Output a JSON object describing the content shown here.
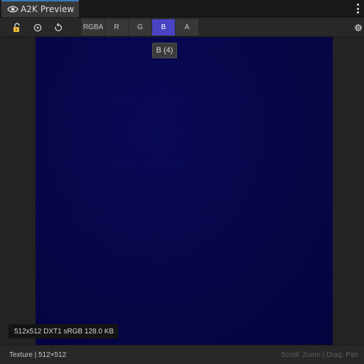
{
  "window": {
    "tab_title": "A2K Preview",
    "tab_icon": "eye-icon",
    "menu_icon": "kebab-menu-icon"
  },
  "toolbar": {
    "lock_icon": "lock-open-icon",
    "target_icon": "target-circle-icon",
    "reset_icon": "refresh-icon",
    "settings_icon": "settings-gear-icon",
    "channels": [
      {
        "label": "RGBA",
        "active": false
      },
      {
        "label": "R",
        "active": false
      },
      {
        "label": "G",
        "active": false
      },
      {
        "label": "B",
        "active": true
      },
      {
        "label": "A",
        "active": false
      }
    ]
  },
  "tooltip": {
    "text": "B (4)"
  },
  "viewport": {
    "info_badge": "512x512  DXT1  sRGB  128.0 KB"
  },
  "statusbar": {
    "left": "Texture | 512×512",
    "right": "Scroll: Zoom | Drag: Pan"
  },
  "colors": {
    "accent_tab": "#3a79bb",
    "active_channel": "#4a43c4",
    "texture_blue": "#07064a",
    "lock_yellow": "#e8b83a"
  }
}
